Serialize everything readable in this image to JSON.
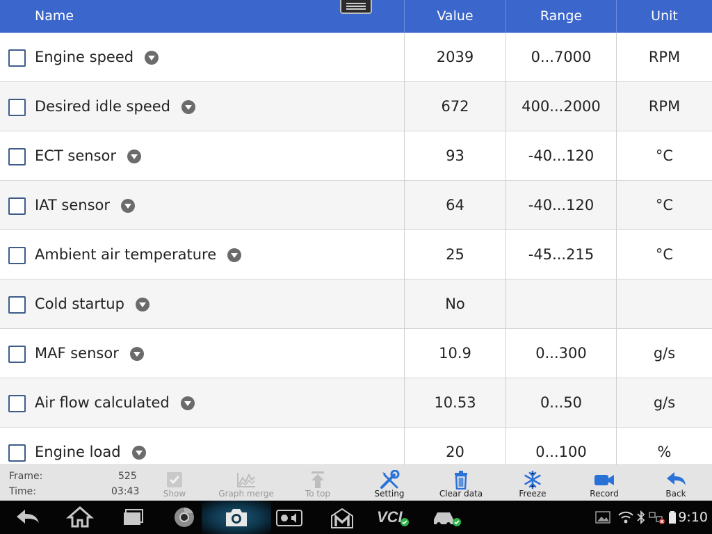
{
  "header": {
    "name_label": "Name",
    "value_label": "Value",
    "range_label": "Range",
    "unit_label": "Unit"
  },
  "rows": [
    {
      "name": "Engine speed",
      "value": "2039",
      "range": "0...7000",
      "unit": "RPM"
    },
    {
      "name": "Desired idle speed",
      "value": "672",
      "range": "400...2000",
      "unit": "RPM"
    },
    {
      "name": "ECT sensor",
      "value": "93",
      "range": "-40...120",
      "unit": "°C"
    },
    {
      "name": "IAT sensor",
      "value": "64",
      "range": "-40...120",
      "unit": "°C"
    },
    {
      "name": "Ambient air temperature",
      "value": "25",
      "range": "-45...215",
      "unit": "°C"
    },
    {
      "name": "Cold startup",
      "value": "No",
      "range": "",
      "unit": ""
    },
    {
      "name": "MAF sensor",
      "value": "10.9",
      "range": "0...300",
      "unit": "g/s"
    },
    {
      "name": "Air flow calculated",
      "value": "10.53",
      "range": "0...50",
      "unit": "g/s"
    },
    {
      "name": "Engine load",
      "value": "20",
      "range": "0...100",
      "unit": "%"
    }
  ],
  "toolbar": {
    "frame_label": "Frame:",
    "frame_value": "525",
    "time_label": "Time:",
    "time_value": "03:43",
    "show_label": "Show",
    "graph_merge_label": "Graph merge",
    "to_top_label": "To top",
    "setting_label": "Setting",
    "clear_data_label": "Clear data",
    "freeze_label": "Freeze",
    "record_label": "Record",
    "back_label": "Back"
  },
  "system_bar": {
    "clock": "9:10",
    "vci_label": "VCI"
  },
  "colors": {
    "header_bg": "#3b66cc",
    "accent_blue": "#2a72d8",
    "checkbox_border": "#3e5c8a"
  },
  "icons": {
    "show": "checkbox-icon",
    "graph_merge": "graph-icon",
    "to_top": "arrow-up-icon",
    "setting": "wrench-screwdriver-icon",
    "clear_data": "trash-icon",
    "freeze": "snowflake-icon",
    "record": "video-camera-icon",
    "back": "back-arrow-icon"
  }
}
